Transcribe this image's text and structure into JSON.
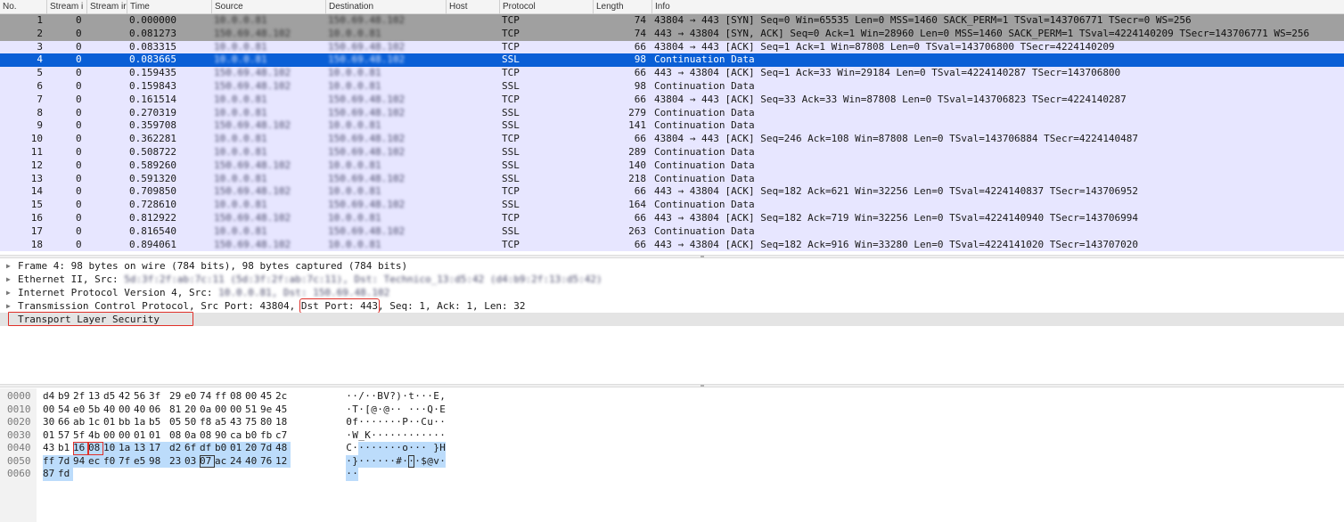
{
  "columns": [
    "No.",
    "Stream i",
    "Stream ir",
    "Time",
    "Source",
    "Destination",
    "Host",
    "Protocol",
    "Length",
    "Info"
  ],
  "packets": [
    {
      "no": "1",
      "stream": "0",
      "time": "0.000000",
      "src": "10.0.0.81",
      "dst": "150.69.48.102",
      "proto": "TCP",
      "len": "74",
      "info": "43804 → 443 [SYN] Seq=0 Win=65535 Len=0 MSS=1460 SACK_PERM=1 TSval=143706771 TSecr=0 WS=256",
      "style": "syn"
    },
    {
      "no": "2",
      "stream": "0",
      "time": "0.081273",
      "src": "150.69.48.102",
      "dst": "10.0.0.81",
      "proto": "TCP",
      "len": "74",
      "info": "443 → 43804 [SYN, ACK] Seq=0 Ack=1 Win=28960 Len=0 MSS=1460 SACK_PERM=1 TSval=4224140209 TSecr=143706771 WS=256",
      "style": "syn"
    },
    {
      "no": "3",
      "stream": "0",
      "time": "0.083315",
      "src": "10.0.0.81",
      "dst": "150.69.48.102",
      "proto": "TCP",
      "len": "66",
      "info": "43804 → 443 [ACK] Seq=1 Ack=1 Win=87808 Len=0 TSval=143706800 TSecr=4224140209",
      "style": "tcp"
    },
    {
      "no": "4",
      "stream": "0",
      "time": "0.083665",
      "src": "10.0.0.81",
      "dst": "150.69.48.102",
      "proto": "SSL",
      "len": "98",
      "info": "Continuation Data",
      "style": "sel"
    },
    {
      "no": "5",
      "stream": "0",
      "time": "0.159435",
      "src": "150.69.48.102",
      "dst": "10.0.0.81",
      "proto": "TCP",
      "len": "66",
      "info": "443 → 43804 [ACK] Seq=1 Ack=33 Win=29184 Len=0 TSval=4224140287 TSecr=143706800",
      "style": "tcp"
    },
    {
      "no": "6",
      "stream": "0",
      "time": "0.159843",
      "src": "150.69.48.102",
      "dst": "10.0.0.81",
      "proto": "SSL",
      "len": "98",
      "info": "Continuation Data",
      "style": "ssl"
    },
    {
      "no": "7",
      "stream": "0",
      "time": "0.161514",
      "src": "10.0.0.81",
      "dst": "150.69.48.102",
      "proto": "TCP",
      "len": "66",
      "info": "43804 → 443 [ACK] Seq=33 Ack=33 Win=87808 Len=0 TSval=143706823 TSecr=4224140287",
      "style": "tcp"
    },
    {
      "no": "8",
      "stream": "0",
      "time": "0.270319",
      "src": "10.0.0.81",
      "dst": "150.69.48.102",
      "proto": "SSL",
      "len": "279",
      "info": "Continuation Data",
      "style": "ssl"
    },
    {
      "no": "9",
      "stream": "0",
      "time": "0.359708",
      "src": "150.69.48.102",
      "dst": "10.0.0.81",
      "proto": "SSL",
      "len": "141",
      "info": "Continuation Data",
      "style": "ssl"
    },
    {
      "no": "10",
      "stream": "0",
      "time": "0.362281",
      "src": "10.0.0.81",
      "dst": "150.69.48.102",
      "proto": "TCP",
      "len": "66",
      "info": "43804 → 443 [ACK] Seq=246 Ack=108 Win=87808 Len=0 TSval=143706884 TSecr=4224140487",
      "style": "tcp"
    },
    {
      "no": "11",
      "stream": "0",
      "time": "0.508722",
      "src": "10.0.0.81",
      "dst": "150.69.48.102",
      "proto": "SSL",
      "len": "289",
      "info": "Continuation Data",
      "style": "ssl"
    },
    {
      "no": "12",
      "stream": "0",
      "time": "0.589260",
      "src": "150.69.48.102",
      "dst": "10.0.0.81",
      "proto": "SSL",
      "len": "140",
      "info": "Continuation Data",
      "style": "ssl"
    },
    {
      "no": "13",
      "stream": "0",
      "time": "0.591320",
      "src": "10.0.0.81",
      "dst": "150.69.48.102",
      "proto": "SSL",
      "len": "218",
      "info": "Continuation Data",
      "style": "ssl"
    },
    {
      "no": "14",
      "stream": "0",
      "time": "0.709850",
      "src": "150.69.48.102",
      "dst": "10.0.0.81",
      "proto": "TCP",
      "len": "66",
      "info": "443 → 43804 [ACK] Seq=182 Ack=621 Win=32256 Len=0 TSval=4224140837 TSecr=143706952",
      "style": "tcp"
    },
    {
      "no": "15",
      "stream": "0",
      "time": "0.728610",
      "src": "10.0.0.81",
      "dst": "150.69.48.102",
      "proto": "SSL",
      "len": "164",
      "info": "Continuation Data",
      "style": "ssl"
    },
    {
      "no": "16",
      "stream": "0",
      "time": "0.812922",
      "src": "150.69.48.102",
      "dst": "10.0.0.81",
      "proto": "TCP",
      "len": "66",
      "info": "443 → 43804 [ACK] Seq=182 Ack=719 Win=32256 Len=0 TSval=4224140940 TSecr=143706994",
      "style": "tcp"
    },
    {
      "no": "17",
      "stream": "0",
      "time": "0.816540",
      "src": "10.0.0.81",
      "dst": "150.69.48.102",
      "proto": "SSL",
      "len": "263",
      "info": "Continuation Data",
      "style": "ssl"
    },
    {
      "no": "18",
      "stream": "0",
      "time": "0.894061",
      "src": "150.69.48.102",
      "dst": "10.0.0.81",
      "proto": "TCP",
      "len": "66",
      "info": "443 → 43804 [ACK] Seq=182 Ack=916 Win=33280 Len=0 TSval=4224141020 TSecr=143707020",
      "style": "tcp"
    }
  ],
  "details": {
    "frame": "Frame 4: 98 bytes on wire (784 bits), 98 bytes captured (784 bits)",
    "ethernet_prefix": "Ethernet II, Src: ",
    "ethernet_blurred": "5d:3f:2f:ab:7c:11 (5d:3f:2f:ab:7c:11), Dst: Technico_13:d5:42 (d4:b9:2f:13:d5:42)",
    "ip_prefix": "Internet Protocol Version 4, Src: ",
    "ip_blurred": "10.0.0.81, Dst: 150.69.48.102",
    "tcp_prefix": "Transmission Control Protocol, Src Port: 43804, ",
    "tcp_dst_port": "Dst Port: 443",
    "tcp_suffix": ", Seq: 1, Ack: 1, Len: 32",
    "tls": "Transport Layer Security"
  },
  "hex": [
    {
      "offset": "0000",
      "bytes": [
        "d4",
        "b9",
        "2f",
        "13",
        "d5",
        "42",
        "56",
        "3f",
        "29",
        "e0",
        "74",
        "ff",
        "08",
        "00",
        "45",
        "2c"
      ],
      "ascii": [
        "·",
        "·",
        "/",
        "·",
        "·",
        "B",
        "V",
        "?",
        ")",
        "·",
        "t",
        "·",
        "·",
        "·",
        "E",
        ","
      ]
    },
    {
      "offset": "0010",
      "bytes": [
        "00",
        "54",
        "e0",
        "5b",
        "40",
        "00",
        "40",
        "06",
        "81",
        "20",
        "0a",
        "00",
        "00",
        "51",
        "9e",
        "45"
      ],
      "ascii": [
        "·",
        "T",
        "·",
        "[",
        "@",
        "·",
        "@",
        "·",
        "·",
        " ",
        "·",
        "·",
        "·",
        "Q",
        "·",
        "E"
      ]
    },
    {
      "offset": "0020",
      "bytes": [
        "30",
        "66",
        "ab",
        "1c",
        "01",
        "bb",
        "1a",
        "b5",
        "05",
        "50",
        "f8",
        "a5",
        "43",
        "75",
        "80",
        "18"
      ],
      "ascii": [
        "0",
        "f",
        "·",
        "·",
        "·",
        "·",
        "·",
        "·",
        "·",
        "P",
        "·",
        "·",
        "C",
        "u",
        "·",
        "·"
      ]
    },
    {
      "offset": "0030",
      "bytes": [
        "01",
        "57",
        "5f",
        "4b",
        "00",
        "00",
        "01",
        "01",
        "08",
        "0a",
        "08",
        "90",
        "ca",
        "b0",
        "fb",
        "c7"
      ],
      "ascii": [
        "·",
        "W",
        "_",
        "K",
        "·",
        "·",
        "·",
        "·",
        "·",
        "·",
        "·",
        "·",
        "·",
        "·",
        "·",
        "·"
      ]
    },
    {
      "offset": "0040",
      "bytes": [
        "43",
        "b1",
        "16",
        "08",
        "10",
        "1a",
        "13",
        "17",
        "d2",
        "6f",
        "df",
        "b0",
        "01",
        "20",
        "7d",
        "48"
      ],
      "ascii": [
        "C",
        "·",
        "·",
        "·",
        "·",
        "·",
        "·",
        "·",
        "·",
        "o",
        "·",
        "·",
        "·",
        " ",
        "}",
        "H"
      ]
    },
    {
      "offset": "0050",
      "bytes": [
        "ff",
        "7d",
        "94",
        "ec",
        "f0",
        "7f",
        "e5",
        "98",
        "23",
        "03",
        "07",
        "ac",
        "24",
        "40",
        "76",
        "12"
      ],
      "ascii": [
        "·",
        "}",
        "·",
        "·",
        "·",
        "·",
        "·",
        "·",
        "#",
        "·",
        "·",
        "·",
        "$",
        "@",
        "v",
        "·"
      ]
    },
    {
      "offset": "0060",
      "bytes": [
        "87",
        "fd"
      ],
      "ascii": [
        "·",
        "·"
      ]
    }
  ],
  "colors": {
    "selected": "#0a5fd6",
    "row": "#e7e6ff",
    "syn": "#a0a0a0",
    "hexHighlight": "#bcdcfb",
    "annotation": "#e0302a"
  }
}
